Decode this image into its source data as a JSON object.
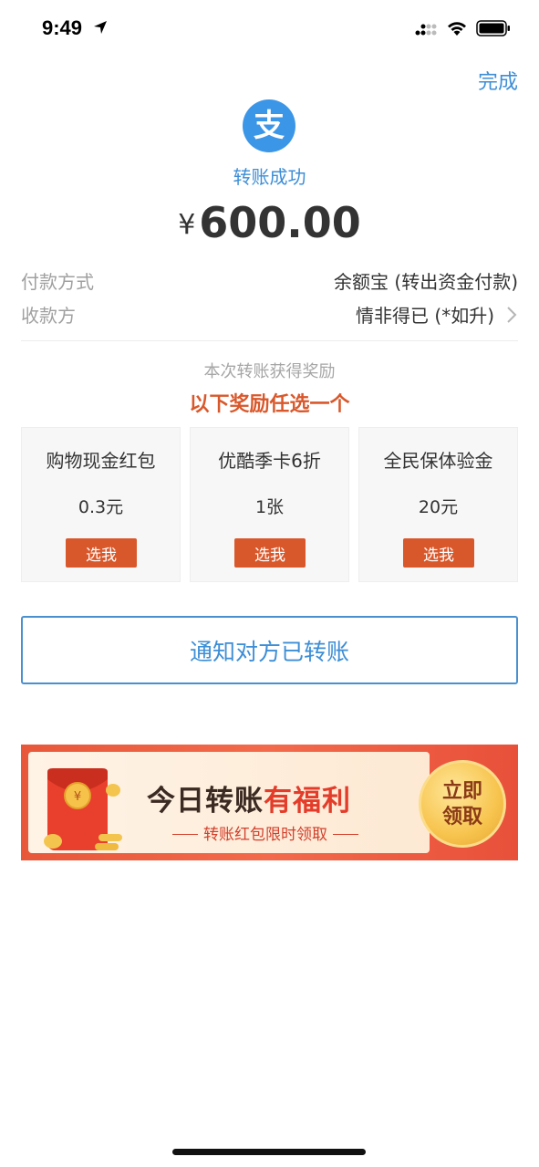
{
  "status_bar": {
    "time": "9:49"
  },
  "header": {
    "done_label": "完成"
  },
  "result": {
    "status_text": "转账成功",
    "currency_symbol": "¥",
    "amount": "600.00"
  },
  "details": {
    "payment_method_label": "付款方式",
    "payment_method_value": "余额宝 (转出资金付款)",
    "payee_label": "收款方",
    "payee_value": "情非得已 (*如升)"
  },
  "rewards": {
    "subtitle": "本次转账获得奖励",
    "title": "以下奖励任选一个",
    "items": [
      {
        "name": "购物现金红包",
        "value": "0.3元",
        "button": "选我"
      },
      {
        "name": "优酷季卡6折",
        "value": "1张",
        "button": "选我"
      },
      {
        "name": "全民保体验金",
        "value": "20元",
        "button": "选我"
      }
    ]
  },
  "notify_button": "通知对方已转账",
  "banner": {
    "title_part1": "今日转账",
    "title_part2": "有福利",
    "subtitle": "转账红包限时领取",
    "claim_line1": "立即",
    "claim_line2": "领取"
  },
  "colors": {
    "accent_blue": "#3d8ed6",
    "reward_orange": "#d9582b"
  }
}
